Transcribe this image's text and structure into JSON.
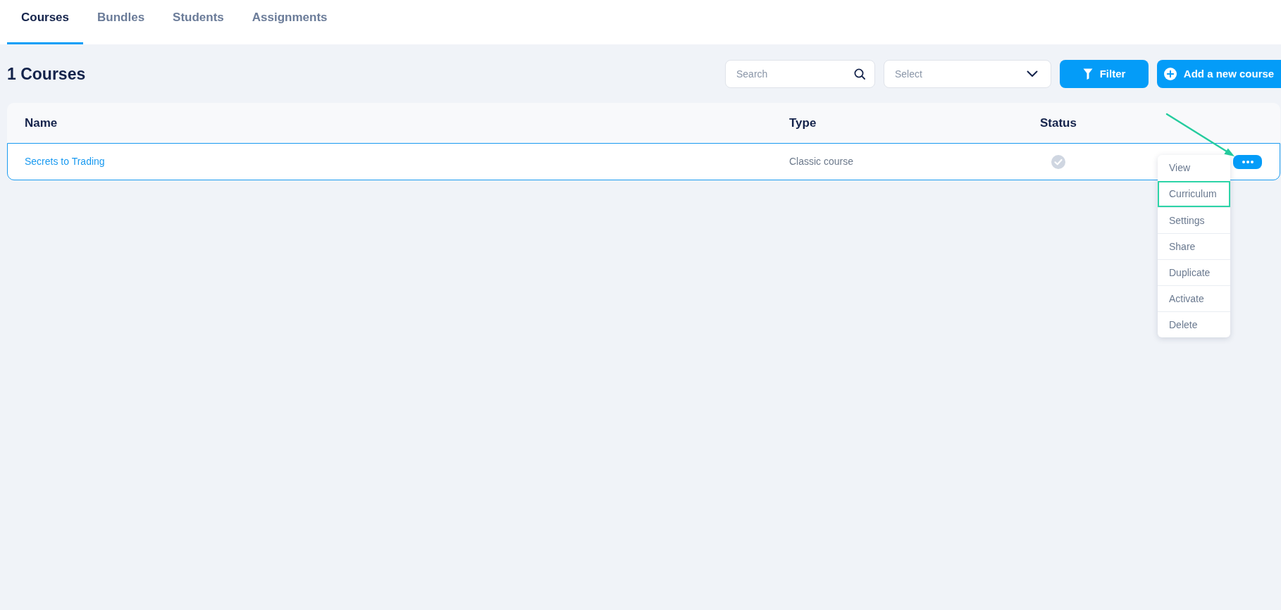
{
  "tabs": [
    {
      "label": "Courses",
      "selected": true
    },
    {
      "label": "Bundles",
      "selected": false
    },
    {
      "label": "Students",
      "selected": false
    },
    {
      "label": "Assignments",
      "selected": false
    }
  ],
  "header": {
    "title": "1 Courses",
    "search": {
      "placeholder": "Search"
    },
    "select": {
      "placeholder": "Select"
    },
    "buttons": [
      {
        "kind": "filter",
        "label": "Filter"
      },
      {
        "kind": "add",
        "label": "Add a new course"
      }
    ]
  },
  "table": {
    "columns": [
      "Name",
      "Type",
      "Status"
    ],
    "rows": [
      {
        "name": "Secrets to Trading",
        "type": "Classic course",
        "active": false,
        "selected": true,
        "menu": [
          {
            "label": "View",
            "highlighted": false
          },
          {
            "label": "Curriculum",
            "highlighted": true
          },
          {
            "label": "Settings",
            "highlighted": false
          },
          {
            "label": "Share",
            "highlighted": false
          },
          {
            "label": "Duplicate",
            "highlighted": false
          },
          {
            "label": "Activate",
            "highlighted": false
          },
          {
            "label": "Delete",
            "highlighted": false
          }
        ]
      }
    ]
  }
}
